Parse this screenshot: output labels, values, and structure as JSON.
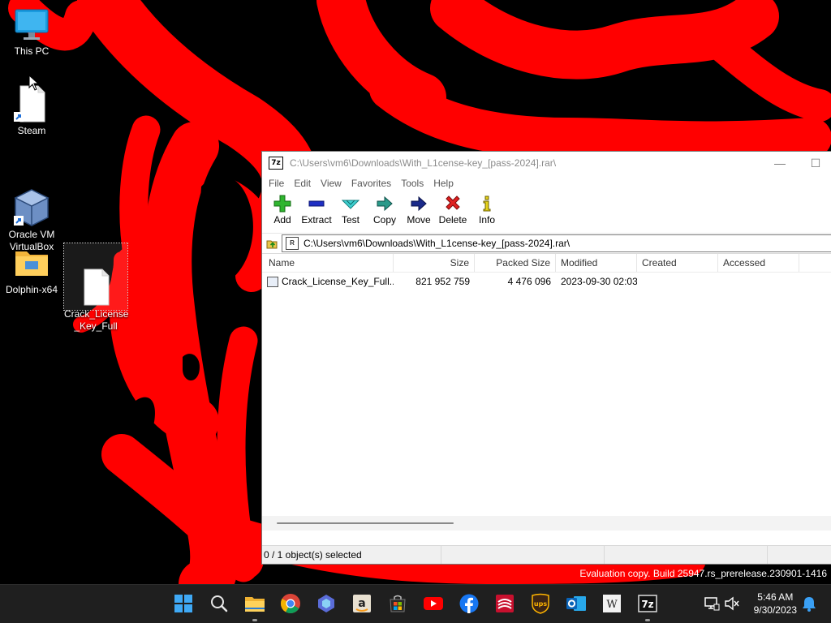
{
  "desktop": {
    "icons": [
      {
        "label": "This PC"
      },
      {
        "label": "Steam"
      },
      {
        "label": "Oracle VM\nVirtualBox"
      },
      {
        "label": "Dolphin-x64"
      },
      {
        "label": "Crack_License\n_Key_Full"
      }
    ]
  },
  "window": {
    "app_icon_text": "7z",
    "title": "C:\\Users\\vm6\\Downloads\\With_L1cense-key_[pass-2024].rar\\",
    "menu": [
      "File",
      "Edit",
      "View",
      "Favorites",
      "Tools",
      "Help"
    ],
    "toolbar": [
      {
        "label": "Add",
        "icon": "add-icon"
      },
      {
        "label": "Extract",
        "icon": "extract-icon"
      },
      {
        "label": "Test",
        "icon": "test-icon"
      },
      {
        "label": "Copy",
        "icon": "copy-icon"
      },
      {
        "label": "Move",
        "icon": "move-icon"
      },
      {
        "label": "Delete",
        "icon": "delete-icon"
      },
      {
        "label": "Info",
        "icon": "info-icon"
      }
    ],
    "address": "C:\\Users\\vm6\\Downloads\\With_L1cense-key_[pass-2024].rar\\",
    "columns": [
      "Name",
      "Size",
      "Packed Size",
      "Modified",
      "Created",
      "Accessed"
    ],
    "rows": [
      {
        "name": "Crack_License_Key_Full....",
        "size": "821 952 759",
        "packed": "4 476 096",
        "modified": "2023-09-30 02:03",
        "created": "",
        "accessed": ""
      }
    ],
    "status": "0 / 1 object(s) selected"
  },
  "watermark": {
    "line1": "Evaluation copy. Build 25947.rs_prerelease.230901-1416"
  },
  "taskbar": {
    "apps": [
      "start-icon",
      "search-icon",
      "file-explorer-icon",
      "chrome-icon",
      "copilot-icon",
      "amazon-icon",
      "store-icon",
      "youtube-icon",
      "facebook-icon",
      "bank-icon",
      "ups-icon",
      "outlook-icon",
      "wikipedia-icon",
      "7zip-icon"
    ],
    "time": "5:46 AM",
    "date": "9/30/2023"
  },
  "colors": {
    "wallpaper_base": "#000000",
    "wallpaper_paint": "#ff0000",
    "taskbar": "#1f1f1f"
  }
}
